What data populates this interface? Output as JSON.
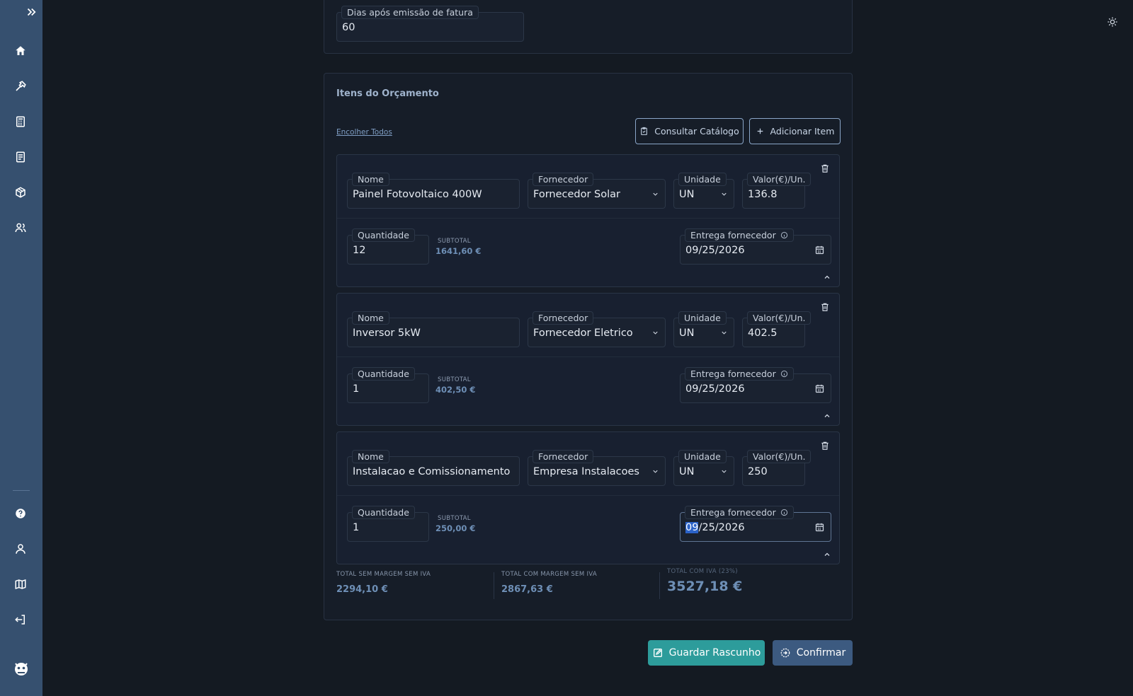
{
  "payment": {
    "days_label": "Dias após emissão de fatura",
    "days_value": "60"
  },
  "items_section": {
    "title": "Itens do Orçamento",
    "collapse_all": "Encolher Todos",
    "catalog_button": "Consultar Catálogo",
    "add_item_button": "Adicionar Item"
  },
  "labels": {
    "name": "Nome",
    "supplier": "Fornecedor",
    "unit": "Unidade",
    "unit_price": "Valor(€)/Un.",
    "quantity": "Quantidade",
    "subtotal": "SUBTOTAL",
    "delivery": "Entrega fornecedor"
  },
  "items": [
    {
      "name": "Painel Fotovoltaico 400W",
      "supplier": "Fornecedor Solar",
      "unit": "UN",
      "unit_price": "136.8",
      "quantity": "12",
      "subtotal": "1641,60 €",
      "delivery": "09/25/2026"
    },
    {
      "name": "Inversor 5kW",
      "supplier": "Fornecedor Eletrico",
      "unit": "UN",
      "unit_price": "402.5",
      "quantity": "1",
      "subtotal": "402,50 €",
      "delivery": "09/25/2026"
    },
    {
      "name": "Instalacao e Comissionamento",
      "supplier": "Empresa Instalacoes",
      "unit": "UN",
      "unit_price": "250",
      "quantity": "1",
      "subtotal": "250,00 €",
      "delivery_sel": "09",
      "delivery_rest": "/25/2026"
    }
  ],
  "totals": {
    "no_margin_no_vat_label": "TOTAL SEM MARGEM SEM IVA",
    "no_margin_no_vat_value": "2294,10 €",
    "margin_no_vat_label": "TOTAL COM MARGEM SEM IVA",
    "margin_no_vat_value": "2867,63 €",
    "with_vat_label": "TOTAL COM IVA (23%)",
    "with_vat_value": "3527,18 €"
  },
  "actions": {
    "save_draft": "Guardar Rascunho",
    "confirm": "Confirmar"
  },
  "icons": {
    "sidebar": [
      "double-chevron-right-icon",
      "home-icon",
      "hammer-icon",
      "calculator-icon",
      "document-icon",
      "package-icon",
      "users-icon",
      "help-icon",
      "user-icon",
      "map-icon",
      "logout-icon",
      "logo-icon"
    ],
    "theme": "sun-icon"
  },
  "colors": {
    "sidebar": "#36506f",
    "background": "#141a22",
    "save": "#2d9c9b",
    "confirm": "#3c5a80",
    "accent_text": "#6e8fb6"
  }
}
